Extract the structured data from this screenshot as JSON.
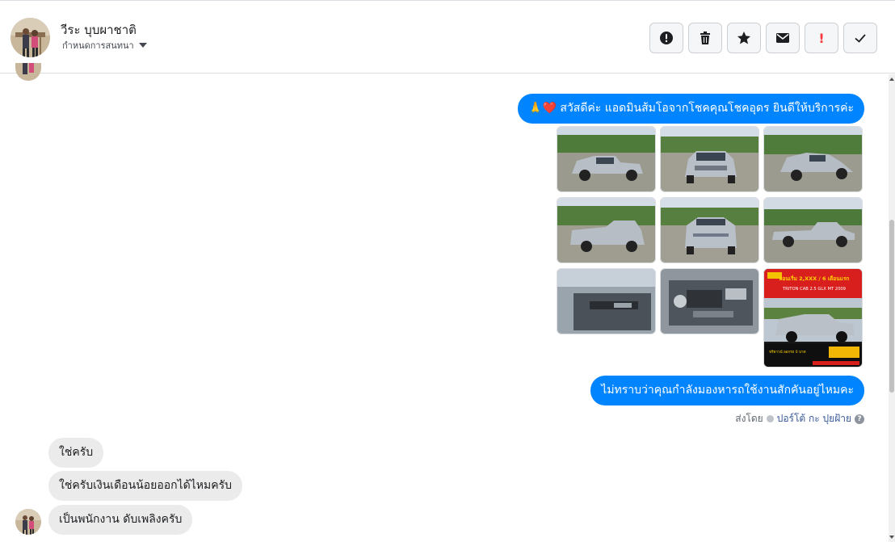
{
  "contact": {
    "name": "วีระ บุบผาชาติ",
    "assign_label": "กำหนดการสนทนา"
  },
  "actions": [
    {
      "name": "mark-spam-button",
      "icon": "alert-circle-icon"
    },
    {
      "name": "delete-button",
      "icon": "trash-icon"
    },
    {
      "name": "star-button",
      "icon": "star-icon"
    },
    {
      "name": "mark-unread-button",
      "icon": "envelope-icon"
    },
    {
      "name": "follow-up-button",
      "icon": "exclamation-icon",
      "label": "!"
    },
    {
      "name": "mark-done-button",
      "icon": "check-icon"
    }
  ],
  "messages": {
    "greeting": "🙏❤️ สวัสดีค่ะ แอดมินส้มโอจากโชคคุณโชคอุดร ยินดีให้บริการค่ะ",
    "question": "ไม่ทราบว่าคุณกำลังมองหารถใช้งานสักคันอยู่ไหมคะ",
    "sent_by_prefix": "ส่งโดย",
    "sent_by_agent": "ปอร์โต้ กะ ปุยฝ้าย",
    "reply_1": "ใช่ครับ",
    "reply_2": "ใช่ครับเงินเดือนน้อยออกได้ไหมครับ",
    "reply_3": "เป็นพนักงาน ดับเพลิงครับ"
  },
  "ad_image": {
    "headline": "ผ่อนเริ่ม 2,XXX / 6 เดือนแรก",
    "model": "TRITON CAB 2.5 GLX MT 2009",
    "price_line": "ฟรีดาวน์ ออกรถ 0 บาท"
  },
  "colors": {
    "accent": "#0084ff",
    "incoming_bubble": "#ebebeb",
    "link": "#385898"
  }
}
